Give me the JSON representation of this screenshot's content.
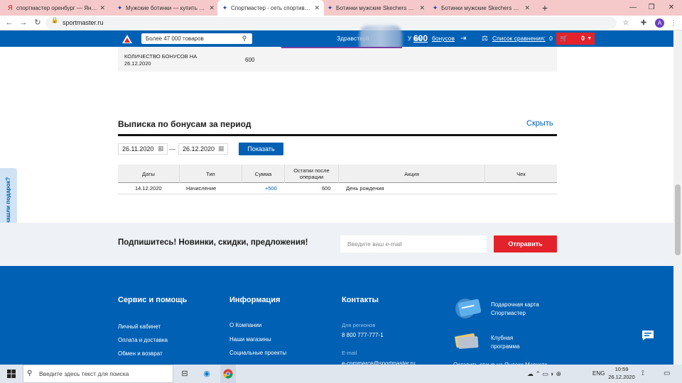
{
  "browser": {
    "tabs": [
      {
        "title": "спортмастер оренбург — Яндекс",
        "favicon": "Я",
        "active": false
      },
      {
        "title": "Мужские ботинки — купить с д",
        "favicon": "✦",
        "active": false
      },
      {
        "title": "Спортмастер - сеть спортивны",
        "favicon": "✦",
        "active": true
      },
      {
        "title": "Ботинки мужские Skechers Bosi",
        "favicon": "✦",
        "active": false
      },
      {
        "title": "Ботинки мужские Skechers Delt",
        "favicon": "✦",
        "active": false
      }
    ],
    "url": "sportmaster.ru",
    "avatar_letter": "A"
  },
  "header": {
    "search_placeholder": "Более 47 000 товаров",
    "greeting": "Здравствуй",
    "bonus_prefix": "У вас",
    "bonus_count": "600",
    "bonus_word": "бонусов",
    "compare_label": "Список сравнения:",
    "compare_count": "0",
    "cart_count": "0"
  },
  "bonus_info": {
    "label": "КОЛИЧЕСТВО БОНУСОВ НА 26.12.2020",
    "value": "600"
  },
  "statement": {
    "title": "Выписка по бонусам за период",
    "hide_link": "Скрыть",
    "date_from": "26.11.2020",
    "dash": "—",
    "date_to": "26.12.2020",
    "show_button": "Показать",
    "columns": [
      "Даты",
      "Тип",
      "Сумма",
      "Остатки после операции",
      "Акция",
      "Чек"
    ],
    "rows": [
      {
        "date": "14.12.2020",
        "type": "Начисление",
        "amount": "+500",
        "balance": "600",
        "promo": "День рождения",
        "receipt": ""
      }
    ]
  },
  "subscribe": {
    "text": "Подпишитесь! Новинки, скидки, предложения!",
    "email_placeholder": "Введите ваш e-mail",
    "send_button": "Отправить"
  },
  "side_tab": {
    "label": "Не нашли подарок?"
  },
  "footer": {
    "service": {
      "title": "Сервис и помощь",
      "links": [
        "Личный кабинет",
        "Оплата и доставка",
        "Обмен и возврат"
      ]
    },
    "info": {
      "title": "Информация",
      "links": [
        "О Компании",
        "Наши магазины",
        "Социальные проекты"
      ]
    },
    "contacts": {
      "title": "Контакты",
      "regions_label": "Для регионов",
      "phone": "8 800 777-777-1",
      "email_label": "E-mail",
      "email": "e-commerce@sportmaster.ru"
    },
    "promo": {
      "gift_card": "Подарочная карта Спортмастер",
      "club": "Клубная программа",
      "review": "Оставить отзыв на Яндекс.Маркете"
    }
  },
  "taskbar": {
    "search_placeholder": "Введите здесь текст для поиска",
    "lang": "ENG",
    "time": "10:59",
    "date": "26.12.2020"
  }
}
